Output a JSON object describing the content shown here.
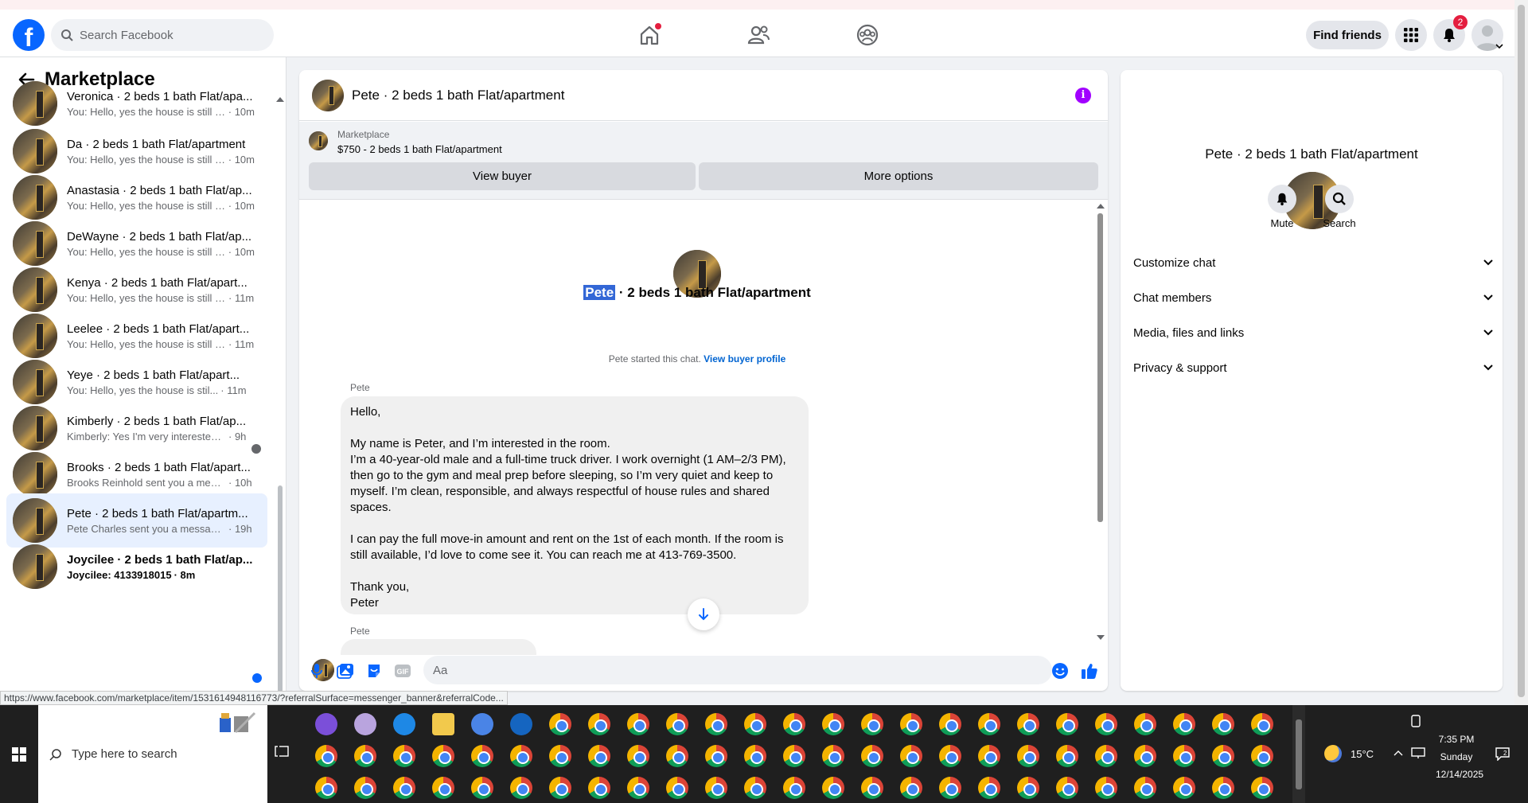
{
  "top": {
    "search_placeholder": "Search Facebook",
    "find_friends": "Find friends",
    "notifications_count": "2",
    "logo_letter": "f"
  },
  "left": {
    "title": "Marketplace",
    "conversations": [
      {
        "name": "Veronica · 2 beds 1 bath Flat/apa...",
        "preview": "You: Hello, yes the house is still a...",
        "time": "· 10m"
      },
      {
        "name": "Da · 2 beds 1 bath Flat/apartment",
        "preview": "You: Hello, yes the house is still a...",
        "time": "· 10m"
      },
      {
        "name": "Anastasia · 2 beds 1 bath Flat/ap...",
        "preview": "You: Hello, yes the house is still a...",
        "time": "· 10m"
      },
      {
        "name": "DeWayne · 2 beds 1 bath Flat/ap...",
        "preview": "You: Hello, yes the house is still a...",
        "time": "· 10m"
      },
      {
        "name": "Kenya · 2 beds 1 bath Flat/apart...",
        "preview": "You: Hello, yes the house is still a...",
        "time": "· 11m"
      },
      {
        "name": "Leelee · 2 beds 1 bath Flat/apart...",
        "preview": "You: Hello, yes the house is still a...",
        "time": "· 11m"
      },
      {
        "name": "Yeye · 2 beds 1 bath Flat/apart...",
        "preview": "You: Hello, yes the house is stil...",
        "time": "· 11m"
      },
      {
        "name": "Kimberly · 2 beds 1 bath Flat/ap...",
        "preview": "Kimberly: Yes I'm very interested int...",
        "time": "· 9h"
      },
      {
        "name": "Brooks · 2 beds 1 bath Flat/apart...",
        "preview": "Brooks Reinhold sent you a messa...",
        "time": "· 10h"
      },
      {
        "name": "Pete · 2 beds 1 bath Flat/apartm...",
        "preview": "Pete Charles sent you a message a...",
        "time": "· 19h"
      },
      {
        "name": "Joycilee · 2 beds 1 bath Flat/ap...",
        "preview": "Joycilee: 4133918015",
        "time": "· 8m"
      }
    ]
  },
  "chat": {
    "title": "Pete · 2 beds 1 bath Flat/apartment",
    "marketplace_label": "Marketplace",
    "listing": "$750 - 2 beds 1 bath Flat/apartment",
    "view_buyer": "View buyer",
    "more_options": "More options",
    "intro_name_highlight": "Pete",
    "intro_name_rest": " · 2 beds 1 bath Flat/apartment",
    "started_text": "Pete started this chat.",
    "view_buyer_profile": "View buyer profile",
    "sender": "Pete",
    "message": "Hello,\n\nMy name is Peter, and I’m interested in the room.\nI’m a 40-year-old male and a full-time truck driver. I work overnight (1 AM–2/3 PM),\nthen go to the gym and meal prep before sleeping, so I’m very quiet and keep to\nmyself. I’m clean, responsible, and always respectful of house rules and shared\nspaces.\n\nI can pay the full move-in amount and rent on the 1st of each month. If the room is\nstill available, I’d love to come see it. You can reach me at 413-769-3500.\n\nThank you,\nPeter",
    "sender2": "Pete",
    "composer_placeholder": "Aa"
  },
  "right": {
    "name": "Pete · 2 beds 1 bath Flat/apartment",
    "mute": "Mute",
    "search": "Search",
    "rows": [
      "Customize chat",
      "Chat members",
      "Media, files and links",
      "Privacy & support"
    ]
  },
  "status_url": "https://www.facebook.com/marketplace/item/1531614948116773/?referralSurface=messenger_banner&referralCode...",
  "taskbar": {
    "search_placeholder": "Type here to search",
    "temperature": "15°C",
    "time": "7:35 PM",
    "day": "Sunday",
    "date": "12/14/2025"
  },
  "colors": {
    "brand": "#0866ff",
    "info": "#a100ff",
    "active_row": "#e7f0ff"
  }
}
